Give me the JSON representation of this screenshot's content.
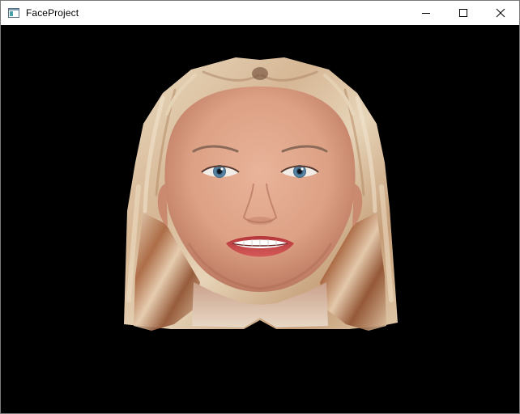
{
  "window": {
    "title": "FaceProject",
    "icon": "app-window-icon",
    "controls": [
      "minimize-icon",
      "maximize-icon",
      "close-icon"
    ]
  },
  "viewport": {
    "background": "#000000",
    "content": "textured-3d-face-model"
  },
  "colors": {
    "hair_light": "#e3cfb1",
    "hair_mid": "#c9a47f",
    "hair_dark": "#8a5a3a",
    "skin": "#e2a98f",
    "skin_shadow": "#c88670",
    "iris": "#5a86a6",
    "lips": "#c4403e"
  }
}
